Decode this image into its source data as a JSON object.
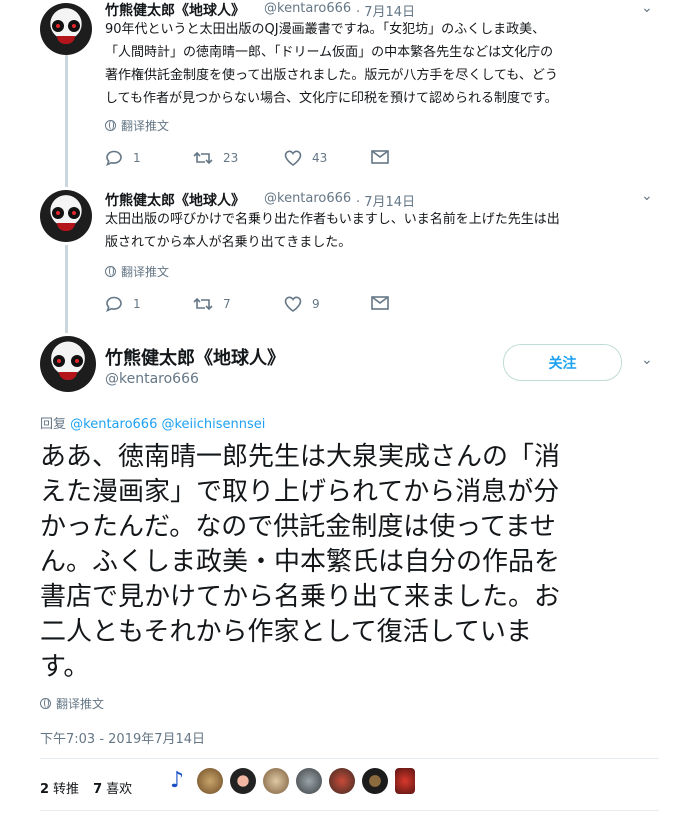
{
  "tweets": [
    {
      "name": "竹熊健太郎《地球人》",
      "handle": "@kentaro666",
      "date": "· 7月14日",
      "lines": [
        "90年代というと太田出版のQJ漫画叢書ですね。「女犯坊」のふくしま政美、",
        "「人間時計」の徳南晴一郎、「ドリーム仮面」の中本繁各先生などは文化庁の",
        "著作権供託金制度を使って出版されました。版元が八方手を尽くしても、どう",
        "しても作者が見つからない場合、文化庁に印税を預けて認められる制度です。"
      ],
      "translate": "翻译推文",
      "replies": "1",
      "retweets": "23",
      "likes": "43"
    },
    {
      "name": "竹熊健太郎《地球人》",
      "handle": "@kentaro666",
      "date": "· 7月14日",
      "lines": [
        "太田出版の呼びかけで名乗り出た作者もいますし、いま名前を上げた先生は出",
        "版されてから本人が名乗り出てきました。"
      ],
      "translate": "翻译推文",
      "replies": "1",
      "retweets": "7",
      "likes": "9"
    }
  ],
  "main": {
    "name": "竹熊健太郎《地球人》",
    "handle": "@kentaro666",
    "follow_label": "关注",
    "reply_prefix": "回复",
    "mentions": "@kentaro666 @keiichisennsei",
    "lines": [
      "ああ、徳南晴一郎先生は大泉実成さんの「消",
      "えた漫画家」で取り上げられてから消息が分",
      "かったんだ。なので供託金制度は使ってませ",
      "ん。ふくしま政美・中本繁氏は自分の作品を",
      "書店で見かけてから名乗り出て来ました。お",
      "二人ともそれから作家として復活していま",
      "す。"
    ],
    "translate": "翻译推文",
    "timestamp": "下午7:03 - 2019年7月14日",
    "retweet_count": "2",
    "retweet_label": "转推",
    "like_count": "7",
    "like_label": "喜欢"
  },
  "colors": {
    "accent": "#1da1f2",
    "muted": "#657786",
    "text": "#14171a"
  }
}
